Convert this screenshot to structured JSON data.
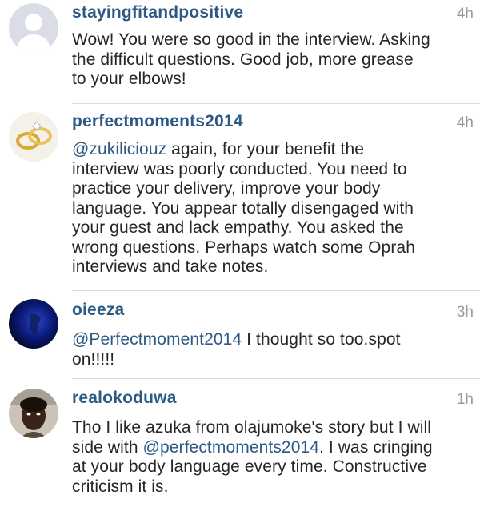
{
  "comments": [
    {
      "username": "stayingfitandpositive",
      "time": "4h",
      "avatar": "default-avatar-icon",
      "lines": [
        {
          "text": "Wow! You were so good in the interview. Asking"
        },
        {
          "text": "the difficult questions. Good job, more grease"
        },
        {
          "text": "to your elbows!"
        }
      ]
    },
    {
      "username": "perfectmoments2014",
      "time": "4h",
      "avatar": "wedding-rings-icon",
      "lines": [
        {
          "mention": "@zukiliciouz",
          "text": " again, for your benefit the"
        },
        {
          "text": "interview was poorly conducted. You need to"
        },
        {
          "text": "practice your delivery, improve your body"
        },
        {
          "text": "language. You appear totally disengaged with"
        },
        {
          "text": "your guest and lack empathy. You asked the"
        },
        {
          "text": "wrong questions. Perhaps watch some Oprah"
        },
        {
          "text": "interviews and take notes."
        }
      ]
    },
    {
      "username": "oieeza",
      "time": "3h",
      "avatar": "dark-blue-avatar",
      "lines": [
        {
          "mention": "@Perfectmoment2014",
          "text": " I thought so too.spot"
        },
        {
          "text": "on!!!!!"
        }
      ]
    },
    {
      "username": "realokoduwa",
      "time": "1h",
      "avatar": "profile-photo",
      "lines": [
        {
          "text": "Tho I like azuka from olajumoke's story but I will"
        },
        {
          "text": "side with ",
          "mention": "@perfectmoments2014",
          "after": ". I was cringing"
        },
        {
          "text": "at your body language every time. Constructive"
        },
        {
          "text": "criticism it is."
        }
      ]
    }
  ],
  "colors": {
    "username": "#2c5a85",
    "mention": "#2c5a85",
    "text": "#262626",
    "time": "#9a9a9a",
    "divider": "#dbdbdb"
  }
}
